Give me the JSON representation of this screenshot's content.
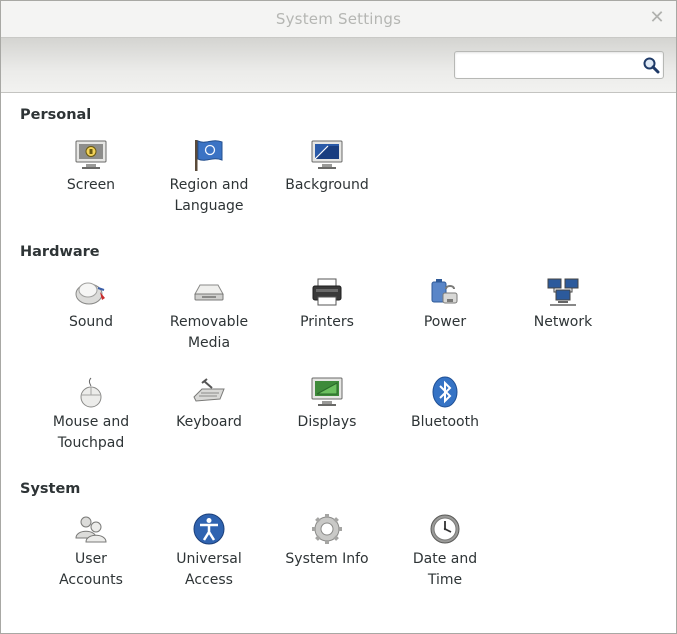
{
  "window": {
    "title": "System Settings"
  },
  "search": {
    "placeholder": "",
    "value": ""
  },
  "sections": {
    "personal": {
      "title": "Personal",
      "items": [
        {
          "label": "Screen",
          "icon": "screen-lock-icon"
        },
        {
          "label": "Region and\nLanguage",
          "icon": "region-flag-icon"
        },
        {
          "label": "Background",
          "icon": "background-icon"
        }
      ]
    },
    "hardware": {
      "title": "Hardware",
      "items": [
        {
          "label": "Sound",
          "icon": "sound-icon"
        },
        {
          "label": "Removable\nMedia",
          "icon": "removable-media-icon"
        },
        {
          "label": "Printers",
          "icon": "printer-icon"
        },
        {
          "label": "Power",
          "icon": "power-icon"
        },
        {
          "label": "Network",
          "icon": "network-icon"
        },
        {
          "label": "Mouse and\nTouchpad",
          "icon": "mouse-icon"
        },
        {
          "label": "Keyboard",
          "icon": "keyboard-icon"
        },
        {
          "label": "Displays",
          "icon": "displays-icon"
        },
        {
          "label": "Bluetooth",
          "icon": "bluetooth-icon"
        }
      ]
    },
    "system": {
      "title": "System",
      "items": [
        {
          "label": "User\nAccounts",
          "icon": "user-accounts-icon"
        },
        {
          "label": "Universal\nAccess",
          "icon": "universal-access-icon"
        },
        {
          "label": "System Info",
          "icon": "gear-icon"
        },
        {
          "label": "Date and\nTime",
          "icon": "clock-icon"
        }
      ]
    }
  }
}
